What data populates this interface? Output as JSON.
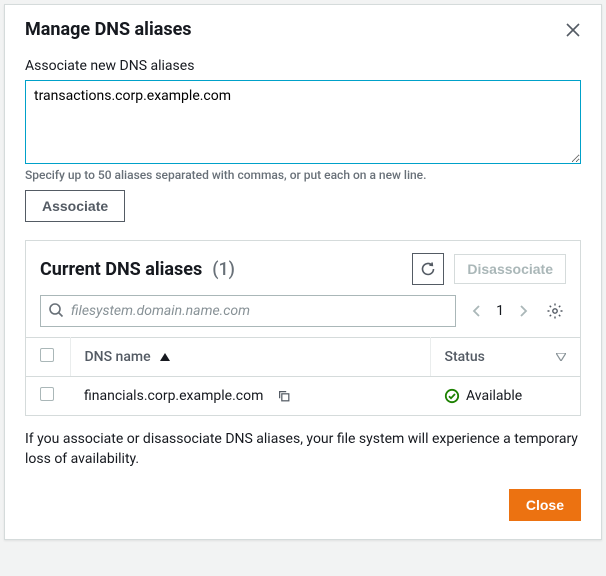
{
  "modal": {
    "title": "Manage DNS aliases"
  },
  "associate": {
    "label": "Associate new DNS aliases",
    "value": "transactions.corp.example.com",
    "hint": "Specify up to 50 aliases separated with commas, or put each on a new line.",
    "button": "Associate"
  },
  "current": {
    "title": "Current DNS aliases",
    "count": "(1)",
    "disassociate": "Disassociate",
    "search_placeholder": "filesystem.domain.name.com",
    "page": "1",
    "columns": {
      "dns": "DNS name",
      "status": "Status"
    },
    "rows": [
      {
        "dns": "financials.corp.example.com",
        "status": "Available"
      }
    ]
  },
  "footer": {
    "note": "If you associate or disassociate DNS aliases, your file system will experience a temporary loss of availability.",
    "close": "Close"
  }
}
